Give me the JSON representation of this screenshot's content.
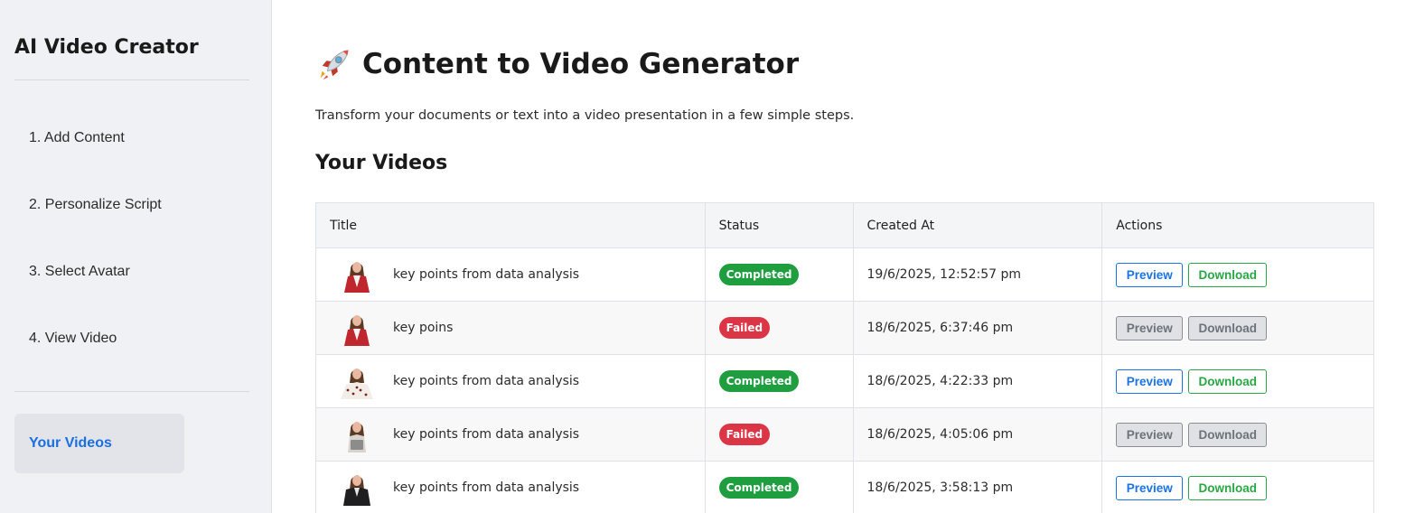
{
  "sidebar": {
    "brand": "AI Video Creator",
    "steps": [
      "1. Add Content",
      "2. Personalize Script",
      "3. Select Avatar",
      "4. View Video"
    ],
    "active_item": "Your Videos"
  },
  "header": {
    "title": "Content to Video Generator",
    "icon": "rocket-icon",
    "subtitle": "Transform your documents or text into a video presentation in a few simple steps."
  },
  "videos": {
    "section_title": "Your Videos",
    "columns": [
      "Title",
      "Status",
      "Created At",
      "Actions"
    ],
    "preview_label": "Preview",
    "download_label": "Download",
    "rows": [
      {
        "title": "key points from data analysis",
        "status": "Completed",
        "created_at": "19/6/2025, 12:52:57 pm",
        "avatar": "red-blazer"
      },
      {
        "title": "key poins",
        "status": "Failed",
        "created_at": "18/6/2025, 6:37:46 pm",
        "avatar": "red-blazer"
      },
      {
        "title": "key points from data analysis",
        "status": "Completed",
        "created_at": "18/6/2025, 4:22:33 pm",
        "avatar": "polka-dot"
      },
      {
        "title": "key points from data analysis",
        "status": "Failed",
        "created_at": "18/6/2025, 4:05:06 pm",
        "avatar": "tablet-holder"
      },
      {
        "title": "key points from data analysis",
        "status": "Completed",
        "created_at": "18/6/2025, 3:58:13 pm",
        "avatar": "dark-jacket"
      }
    ]
  },
  "colors": {
    "completed": "#1e9e3f",
    "failed": "#dc3545",
    "preview": "#1a73e8",
    "download": "#28a745",
    "active_nav": "#1a6fe0"
  }
}
